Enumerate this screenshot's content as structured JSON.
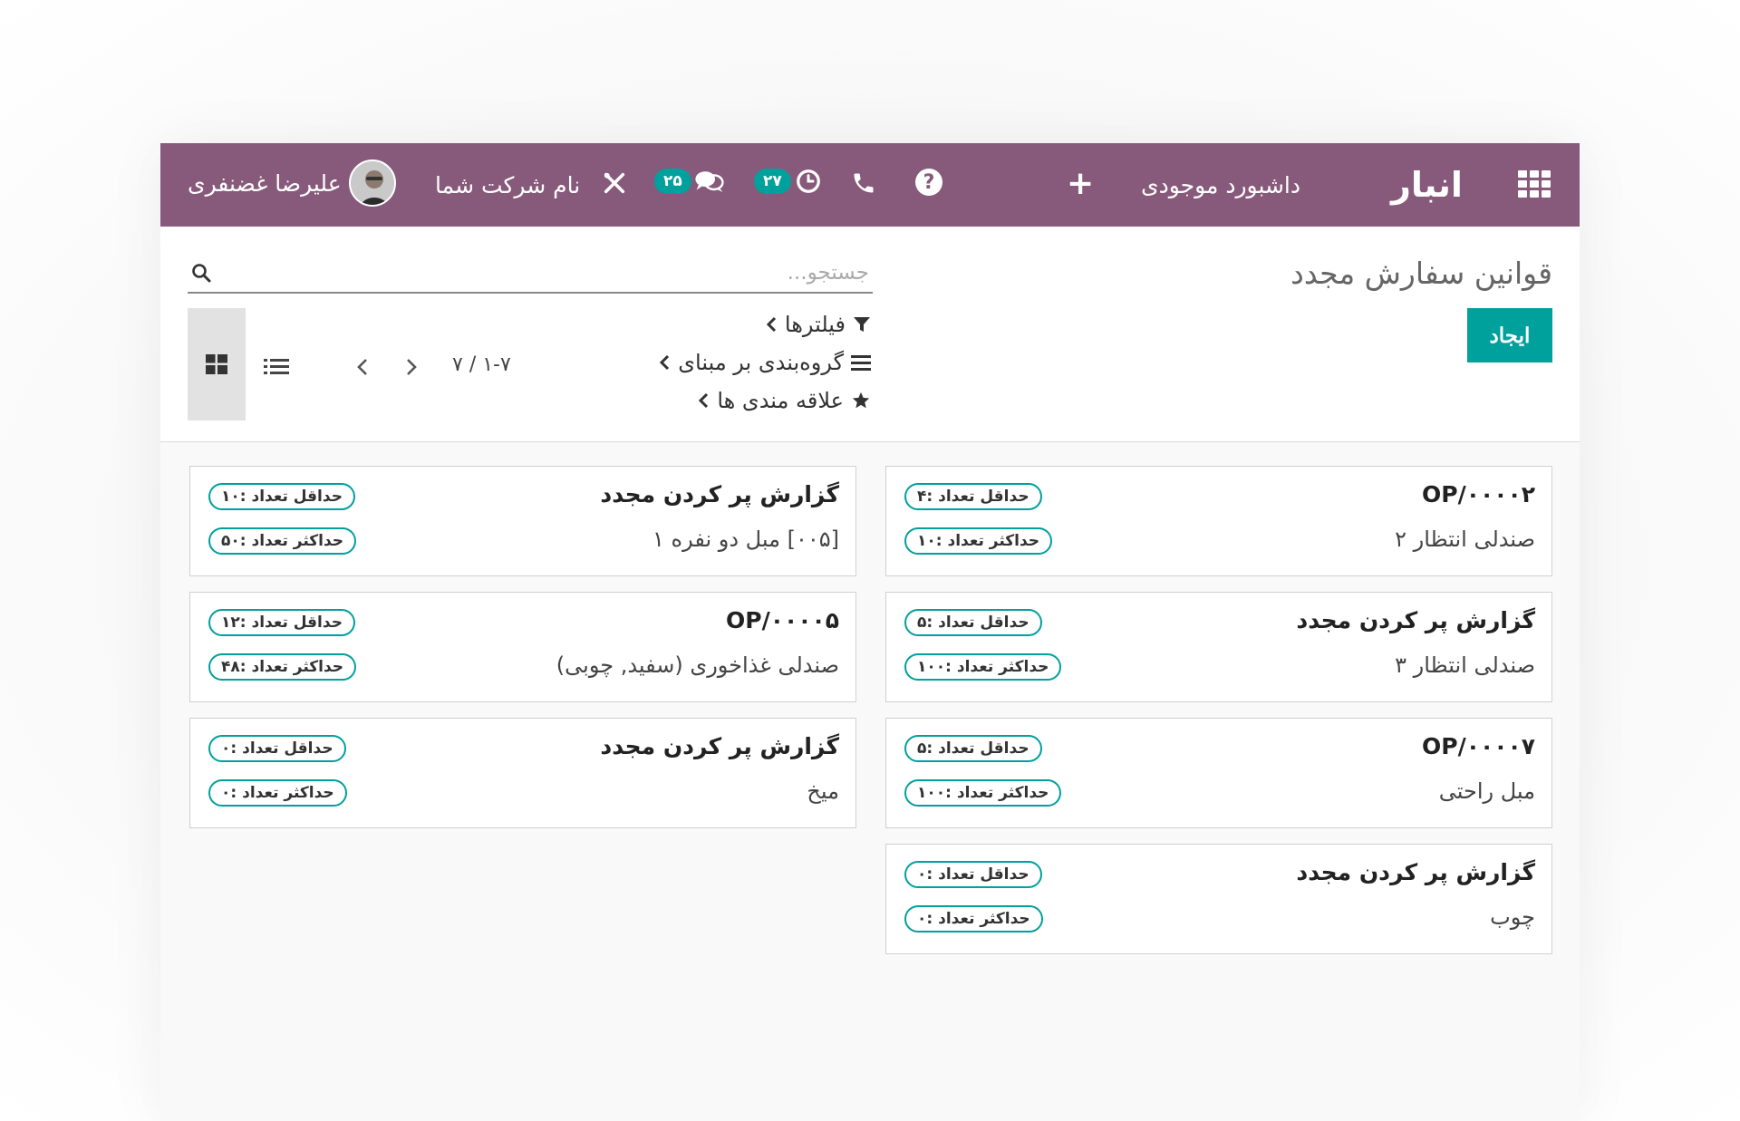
{
  "navbar": {
    "app_title": "انبار",
    "menu_dashboard": "داشبورد موجودی",
    "plus": "+",
    "help": "?",
    "activity_count": "۲۷",
    "message_count": "۲۵",
    "company": "نام شرکت شما",
    "user_name": "علیرضا غضنفری",
    "bg_color": "#875a7b",
    "badge_color": "#00a09d"
  },
  "control": {
    "page_title": "قوانین سفارش مجدد",
    "create_label": "ایجاد",
    "search_placeholder": "جستجو...",
    "filters_label": "فیلترها",
    "groupby_label": "گروه‌بندی بر مبنای",
    "favorites_label": "علاقه مندی ها",
    "pager_value": "۱-۷ / ۷",
    "accent_color": "#00a09d"
  },
  "cards": [
    {
      "title": "OP/۰۰۰۰۲",
      "subtitle": "صندلی انتظار ۲",
      "min": "حداقل تعداد :۴",
      "max": "حداکثر تعداد :۱۰"
    },
    {
      "title": "گزارش پر کردن مجدد",
      "subtitle": "[۰۰۵] مبل دو نفره ۱",
      "min": "حداقل تعداد :۱۰",
      "max": "حداکثر تعداد :۵۰"
    },
    {
      "title": "گزارش پر کردن مجدد",
      "subtitle": "صندلی انتظار ۳",
      "min": "حداقل تعداد :۵",
      "max": "حداکثر تعداد :۱۰۰"
    },
    {
      "title": "OP/۰۰۰۰۵",
      "subtitle": "صندلی غذاخوری (سفید, چوبی)",
      "min": "حداقل تعداد :۱۲",
      "max": "حداکثر تعداد :۴۸"
    },
    {
      "title": "OP/۰۰۰۰۷",
      "subtitle": "مبل راحتی",
      "min": "حداقل تعداد :۵",
      "max": "حداکثر تعداد :۱۰۰"
    },
    {
      "title": "گزارش پر کردن مجدد",
      "subtitle": "میخ",
      "min": "حداقل تعداد :۰",
      "max": "حداکثر تعداد :۰"
    },
    {
      "title": "گزارش پر کردن مجدد",
      "subtitle": "چوب",
      "min": "حداقل تعداد :۰",
      "max": "حداکثر تعداد :۰"
    }
  ]
}
